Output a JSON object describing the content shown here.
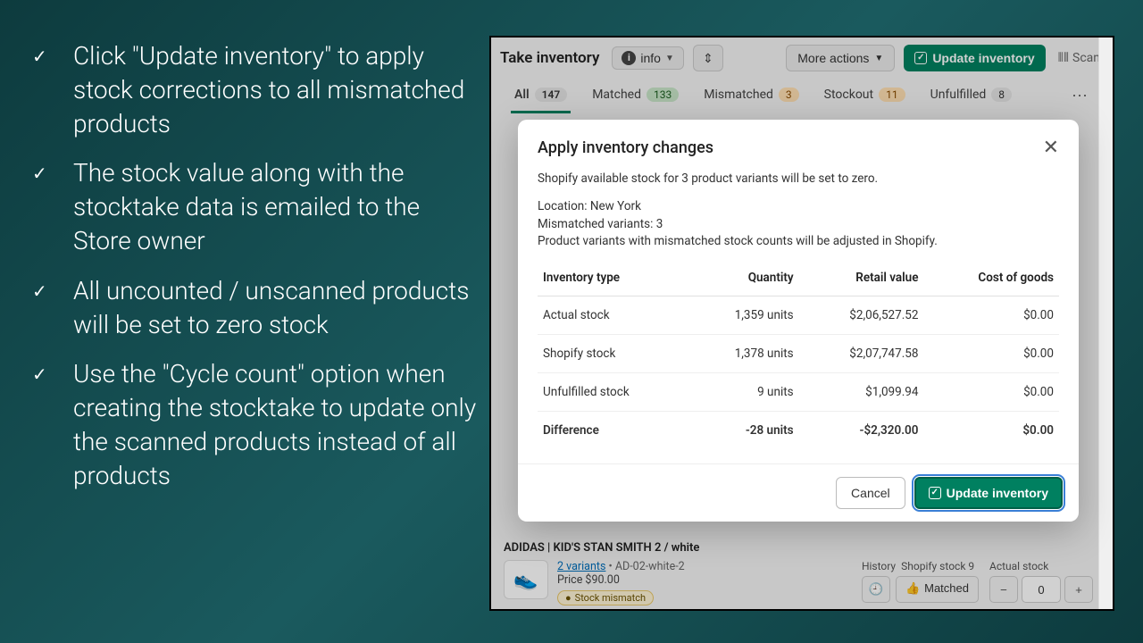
{
  "bullets": [
    "Click \"Update inventory\" to apply stock corrections to all mismatched products",
    "The stock value along with the stocktake data is emailed to the Store owner",
    "All uncounted / unscanned products will be set to zero stock",
    "Use the \"Cycle count\" option when creating the stocktake to update only the scanned products instead of all products"
  ],
  "topbar": {
    "title": "Take inventory",
    "info_label": "info",
    "more_actions": "More actions",
    "update_label": "Update inventory",
    "scan_label": "Scan"
  },
  "tabs": [
    {
      "label": "All",
      "count": "147",
      "badge_class": "",
      "active": true
    },
    {
      "label": "Matched",
      "count": "133",
      "badge_class": "green",
      "active": false
    },
    {
      "label": "Mismatched",
      "count": "3",
      "badge_class": "orange",
      "active": false
    },
    {
      "label": "Stockout",
      "count": "11",
      "badge_class": "orange",
      "active": false
    },
    {
      "label": "Unfulfilled",
      "count": "8",
      "badge_class": "",
      "active": false
    }
  ],
  "modal": {
    "title": "Apply inventory changes",
    "intro": "Shopify available stock for 3 product variants will be set to zero.",
    "location_line": "Location: New York",
    "mismatched_line": "Mismatched variants: 3",
    "adjust_line": "Product variants with mismatched stock counts will be adjusted in Shopify.",
    "headers": {
      "type": "Inventory type",
      "qty": "Quantity",
      "retail": "Retail value",
      "cog": "Cost of goods"
    },
    "rows": [
      {
        "type": "Actual stock",
        "qty": "1,359 units",
        "retail": "$2,06,527.52",
        "cog": "$0.00"
      },
      {
        "type": "Shopify stock",
        "qty": "1,378 units",
        "retail": "$2,07,747.58",
        "cog": "$0.00"
      },
      {
        "type": "Unfulfilled stock",
        "qty": "9 units",
        "retail": "$1,099.94",
        "cog": "$0.00"
      },
      {
        "type": "Difference",
        "qty": "-28 units",
        "retail": "-$2,320.00",
        "cog": "$0.00"
      }
    ],
    "cancel": "Cancel",
    "confirm": "Update inventory"
  },
  "product": {
    "title": "ADIDAS | KID'S STAN SMITH 2 / white",
    "variants_link": "2 variants",
    "sku": "AD-02-white-2",
    "price": "Price $90.00",
    "mismatch": "Stock mismatch",
    "history": "History",
    "shopify_stock_label": "Shopify stock 9",
    "actual_label": "Actual stock",
    "matched": "Matched",
    "actual_value": "0"
  }
}
